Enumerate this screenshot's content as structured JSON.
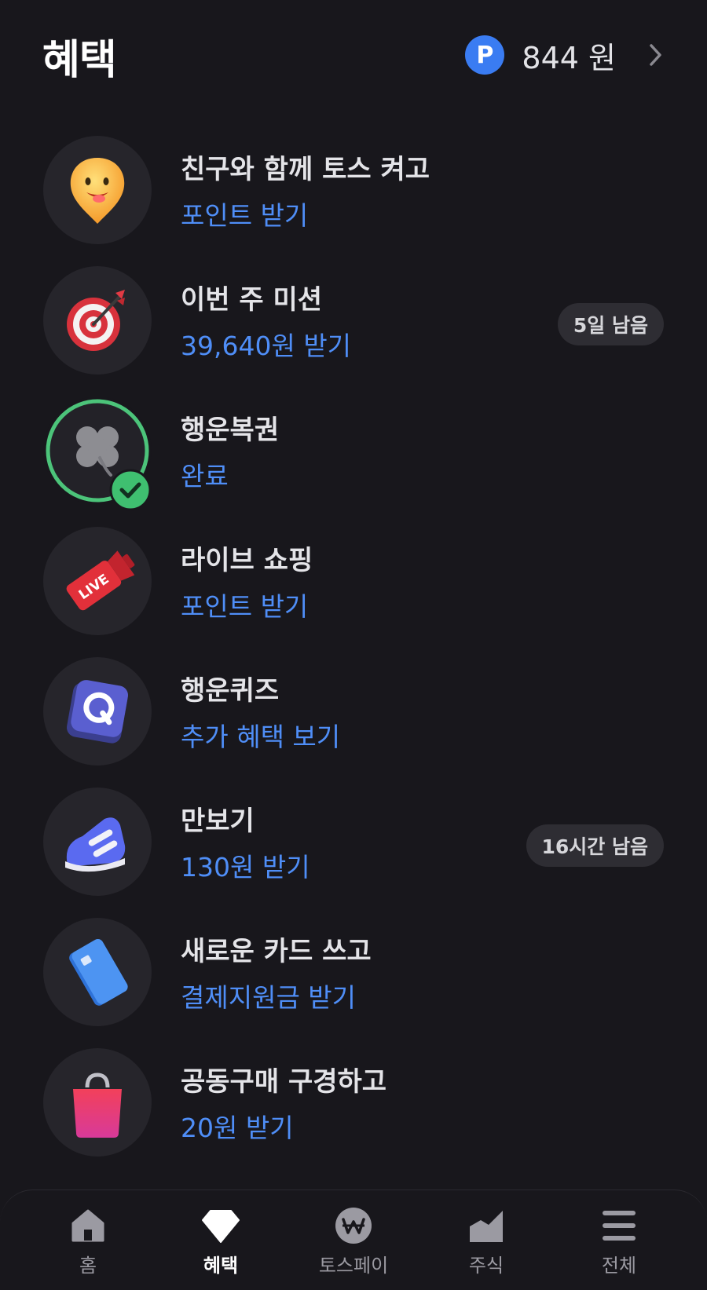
{
  "header": {
    "title": "혜택",
    "points_badge": "P",
    "points_value": "844 원"
  },
  "items": [
    {
      "title": "친구와 함께 토스 켜고",
      "subtitle": "포인트 받기",
      "icon": "smiley-location-pin-icon"
    },
    {
      "title": "이번 주 미션",
      "subtitle": "39,640원 받기",
      "badge": "5일 남음",
      "icon": "dartboard-icon"
    },
    {
      "title": "행운복권",
      "subtitle": "완료",
      "icon": "clover-icon",
      "completed": true
    },
    {
      "title": "라이브 쇼핑",
      "subtitle": "포인트 받기",
      "icon": "live-tag-icon"
    },
    {
      "title": "행운퀴즈",
      "subtitle": "추가 혜택 보기",
      "icon": "quiz-q-icon"
    },
    {
      "title": "만보기",
      "subtitle": "130원 받기",
      "badge": "16시간 남음",
      "icon": "sneaker-icon"
    },
    {
      "title": "새로운 카드 쓰고",
      "subtitle": "결제지원금 받기",
      "icon": "credit-card-icon"
    },
    {
      "title": "공동구매 구경하고",
      "subtitle": "20원 받기",
      "icon": "shopping-bag-icon"
    }
  ],
  "tabbar": {
    "tabs": [
      {
        "label": "홈",
        "icon": "home-icon"
      },
      {
        "label": "혜택",
        "icon": "diamond-icon",
        "active": true
      },
      {
        "label": "토스페이",
        "icon": "won-coin-icon"
      },
      {
        "label": "주식",
        "icon": "stock-chart-icon"
      },
      {
        "label": "전체",
        "icon": "menu-icon"
      }
    ]
  },
  "colors": {
    "background": "#18171c",
    "accent_blue": "#4f8ef7",
    "point_blue": "#3a7cf2",
    "complete_green": "#4cc47a"
  }
}
